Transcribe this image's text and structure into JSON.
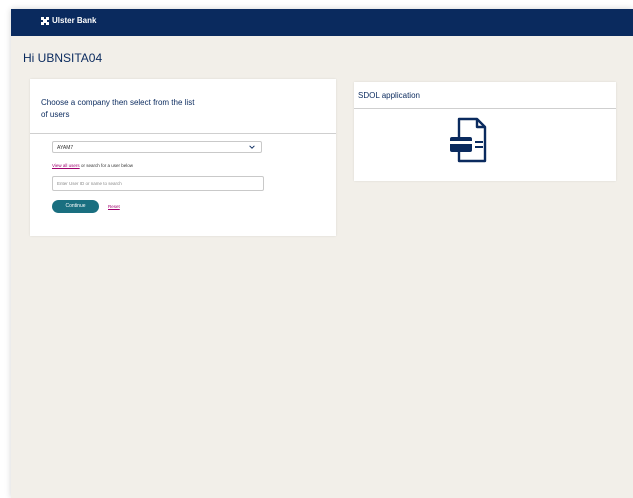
{
  "brand": {
    "name": "Ulster Bank"
  },
  "greeting": "Hi UBNSITA04",
  "company_card": {
    "title": "Choose a company then select from the list of users",
    "selected_company": "AYAM7",
    "view_all_link": "View all users",
    "hint_suffix": " or search for a user below",
    "search_placeholder": "Enter User ID or name to search",
    "continue_label": "Continue",
    "reset_label": "Reset"
  },
  "sdol_card": {
    "title": "SDOL application",
    "icon": "document-card-icon"
  },
  "colors": {
    "header": "#0a2a5e",
    "background": "#f2efe9",
    "button": "#1a6f80",
    "link": "#a0006e"
  }
}
